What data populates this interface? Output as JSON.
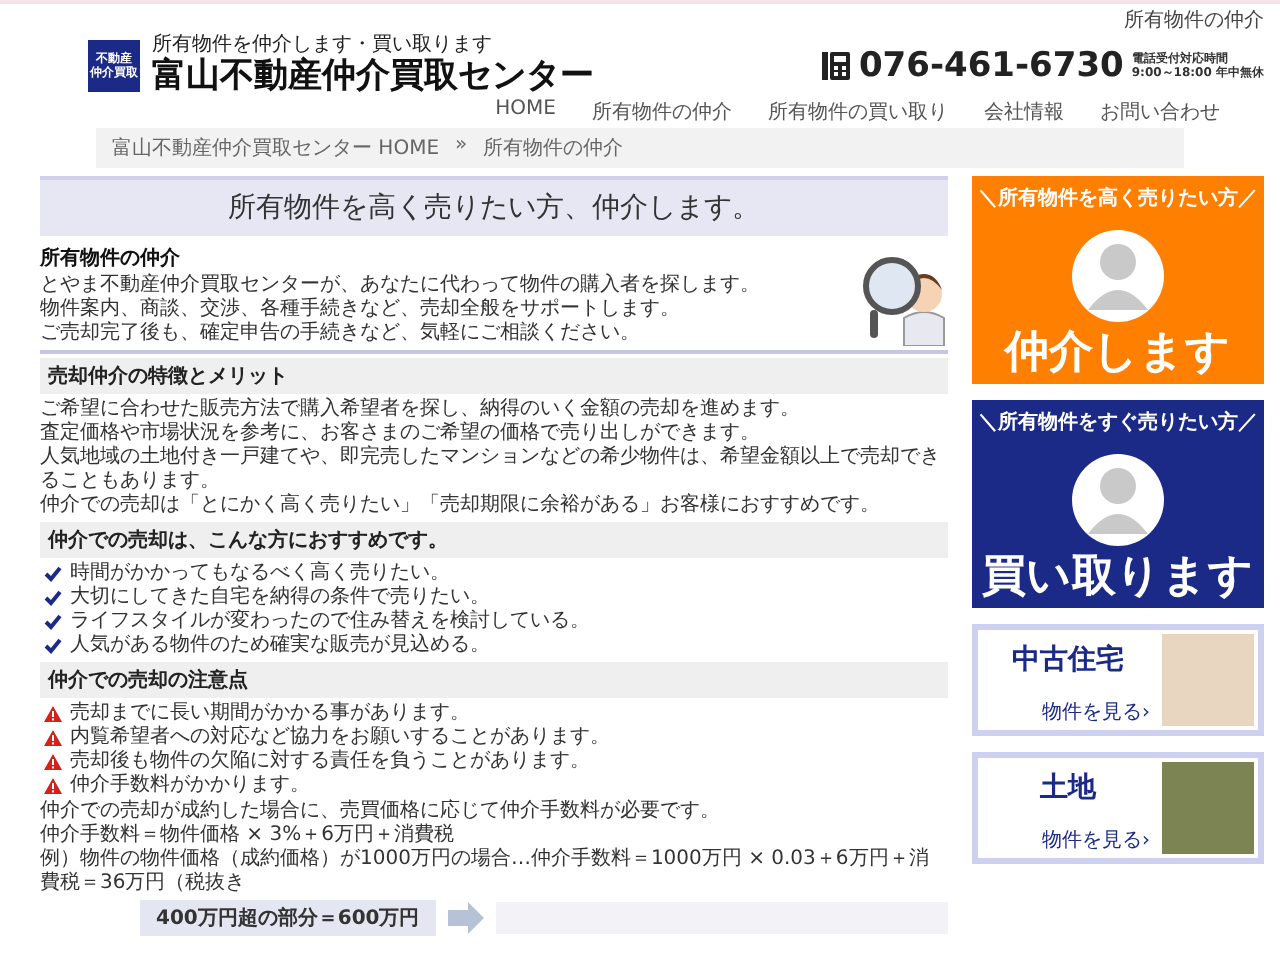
{
  "top_link": "所有物件の仲介",
  "header": {
    "logo_lines": [
      "不動産",
      "仲介買取"
    ],
    "tagline": "所有物件を仲介します・買い取ります",
    "title": "富山不動産仲介買取センター",
    "phone": "076-461-6730",
    "hours_label": "電話受付対応時間",
    "hours": "9:00～18:00 年中無休"
  },
  "nav": [
    "HOME",
    "所有物件の仲介",
    "所有物件の買い取り",
    "会社情報",
    "お問い合わせ"
  ],
  "breadcrumb": {
    "items": [
      "富山不動産仲介買取センター HOME",
      "所有物件の仲介"
    ],
    "separator": "»"
  },
  "banner": {
    "text": "所有物件を高く売りたい方、仲介します。"
  },
  "sections": [
    {
      "kind": "intro",
      "heading": "所有物件の仲介",
      "lines": [
        "とやま不動産仲介買取センターが、あなたに代わって物件の購入者を探します。",
        "物件案内、商談、交渉、各種手続きなど、売却全般をサポートします。",
        "ご売却完了後も、確定申告の手続きなど、気軽にご相談ください。"
      ]
    },
    {
      "kind": "text",
      "heading": "売却仲介の特徴とメリット",
      "lines": [
        "ご希望に合わせた販売方法で購入希望者を探し、納得のいく金額の売却を進めます。",
        "査定価格や市場状況を参考に、お客さまのご希望の価格で売り出しができます。",
        "人気地域の土地付き一戸建てや、即完売したマンションなどの希少物件は、希望金額以上で売却できることもあります。",
        "仲介での売却は「とにかく高く売りたい」「売却期限に余裕がある」お客様におすすめです。"
      ]
    },
    {
      "kind": "checklist",
      "heading": "仲介での売却は、こんな方におすすめです。",
      "lines": [
        "時間がかかってもなるべく高く売りたい。",
        "大切にしてきた自宅を納得の条件で売りたい。",
        "ライフスタイルが変わったので住み替えを検討している。",
        "人気がある物件のため確実な販売が見込める。"
      ]
    },
    {
      "kind": "warnings",
      "heading": "仲介での売却の注意点",
      "lines": [
        "売却までに長い期間がかかる事があります。",
        "内覧希望者への対応など協力をお願いすることがあります。",
        "売却後も物件の欠陥に対する責任を負うことがあります。",
        "仲介手数料がかかります。"
      ],
      "notes": [
        "仲介での売却が成約した場合に、売買価格に応じて仲介手数料が必要です。",
        "仲介手数料＝物件価格 × 3%＋6万円＋消費税",
        "例）物件の物件価格（成約価格）が1000万円の場合…仲介手数料＝1000万円 × 0.03＋6万円＋消費税＝36万円（税抜き"
      ],
      "calc": "400万円超の部分＝600万円"
    }
  ],
  "sidebar": {
    "banners": [
      {
        "caption": "＼所有物件を高く売りたい方／",
        "headline": "仲介します",
        "color": "#ff7f00"
      },
      {
        "caption": "＼所有物件をすぐ売りたい方／",
        "headline": "買い取ります",
        "color": "#1b2a86"
      }
    ],
    "cards": [
      {
        "title": "中古住宅",
        "link": "物件を見る›"
      },
      {
        "title": "土地",
        "link": "物件を見る›"
      }
    ]
  }
}
